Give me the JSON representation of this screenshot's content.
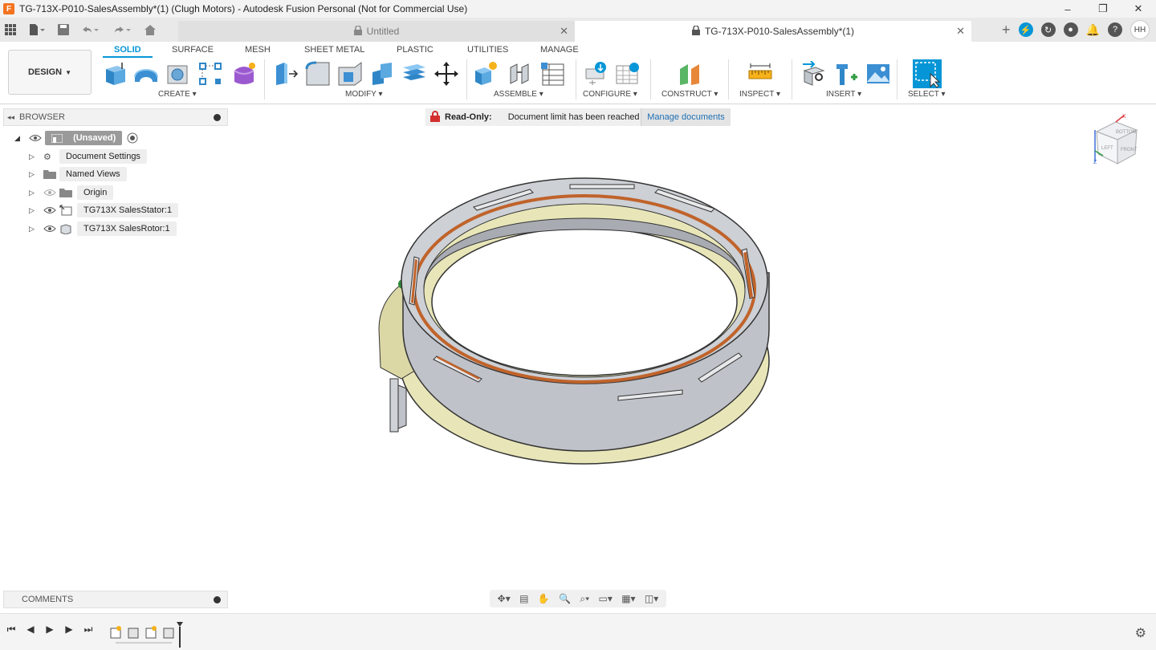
{
  "window": {
    "title": "TG-713X-P010-SalesAssembly*(1) (Clugh Motors) - Autodesk Fusion Personal (Not for Commercial Use)",
    "minimize": "–",
    "restore": "❐",
    "close": "✕"
  },
  "tabs": [
    {
      "label": "Untitled",
      "active": false
    },
    {
      "label": "TG-713X-P010-SalesAssembly*(1)",
      "active": true
    }
  ],
  "user": {
    "initials": "HH"
  },
  "ribbon": {
    "workspace": "DESIGN",
    "tabs": [
      "SOLID",
      "SURFACE",
      "MESH",
      "SHEET METAL",
      "PLASTIC",
      "UTILITIES",
      "MANAGE"
    ],
    "groups": [
      "CREATE",
      "MODIFY",
      "ASSEMBLE",
      "CONFIGURE",
      "CONSTRUCT",
      "INSPECT",
      "INSERT",
      "SELECT"
    ]
  },
  "browser": {
    "title": "BROWSER",
    "root": "(Unsaved)",
    "items": [
      "Document Settings",
      "Named Views",
      "Origin",
      "TG713X SalesStator:1",
      "TG713X  SalesRotor:1"
    ]
  },
  "notice": {
    "label": "Read-Only:",
    "message": "Document limit has been reached",
    "link": "Manage documents"
  },
  "viewcube": {
    "face_front": "FRONT",
    "face_left": "LEFT",
    "face_top": "BOTTOM"
  },
  "comments": {
    "title": "COMMENTS"
  },
  "colors": {
    "accent": "#0696d7",
    "stator": "#bfc2c8",
    "rotor": "#e8e6b8",
    "magnet": "#c0632b"
  }
}
